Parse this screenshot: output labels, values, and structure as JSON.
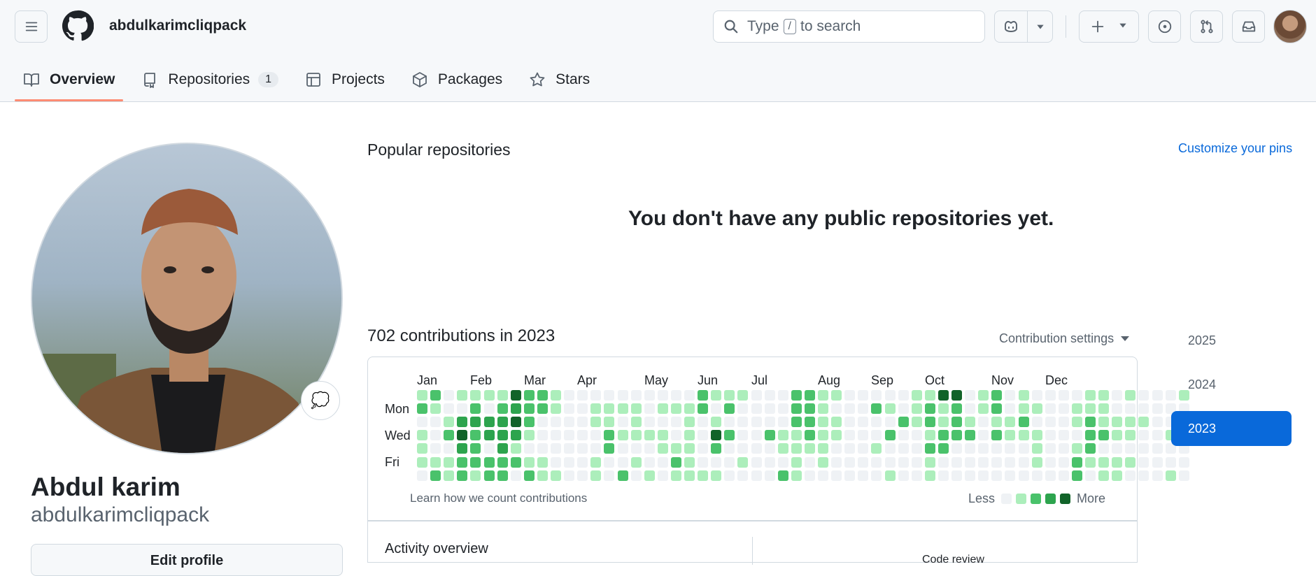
{
  "header": {
    "username": "abdulkarimcliqpack",
    "search": {
      "prefix": "Type",
      "key": "/",
      "suffix": "to search"
    }
  },
  "tabs": [
    {
      "label": "Overview",
      "icon": "book-icon",
      "active": true
    },
    {
      "label": "Repositories",
      "icon": "repo-icon",
      "count": "1"
    },
    {
      "label": "Projects",
      "icon": "table-icon"
    },
    {
      "label": "Packages",
      "icon": "package-icon"
    },
    {
      "label": "Stars",
      "icon": "star-icon"
    }
  ],
  "profile": {
    "full_name": "Abdul karim",
    "handle": "abdulkarimcliqpack",
    "edit_label": "Edit profile",
    "status_icon": "speech-bubble-icon"
  },
  "popular": {
    "title": "Popular repositories",
    "customize": "Customize your pins",
    "empty_message": "You don't have any public repositories yet."
  },
  "contributions": {
    "title": "702 contributions in 2023",
    "settings_label": "Contribution settings",
    "months": [
      "Jan",
      "Feb",
      "Mar",
      "Apr",
      "May",
      "Jun",
      "Jul",
      "Aug",
      "Sep",
      "Oct",
      "Nov",
      "Dec"
    ],
    "days": [
      "Mon",
      "Wed",
      "Fri"
    ],
    "learn_link": "Learn how we count contributions",
    "legend_less": "Less",
    "legend_more": "More",
    "level_colors": [
      "#eff2f5",
      "#aceebb",
      "#4ac26b",
      "#2da44e",
      "#116329"
    ],
    "grid": [
      "1201110",
      "2100012",
      "0012011",
      "1034322",
      "1232221",
      "1033022",
      "1233322",
      "4343120",
      "2221012",
      "2200011",
      "1100001",
      "0000000",
      "0000000",
      "0110011",
      "0112200",
      "0101002",
      "0111010",
      "0001001",
      "0101100",
      "0100121",
      "0111111",
      "2200001",
      "1014201",
      "1202000",
      "1000010",
      "0000000",
      "0002000",
      "0001102",
      "2221111",
      "2222100",
      "1111110",
      "1011000",
      "0000000",
      "0000000",
      "0200100",
      "0102001",
      "0020000",
      "1110000",
      "1221211",
      "4112200",
      "4222000",
      "0012000",
      "1100000",
      "2212000",
      "0011000",
      "1121000",
      "0101110",
      "0000000",
      "0000000",
      "0110122",
      "1122210",
      "1112011",
      "0011011",
      "1011010",
      "0010000",
      "0000000",
      "0001001",
      "1021000"
    ]
  },
  "activity": {
    "title": "Activity overview",
    "right_label": "Code review"
  },
  "years": [
    "2025",
    "2024",
    "2023"
  ],
  "active_year": "2023",
  "colors": {
    "accent_blue": "#0969da",
    "tab_underline": "#fd8c73",
    "border": "#d1d9e0",
    "header_bg": "#f6f8fa"
  }
}
